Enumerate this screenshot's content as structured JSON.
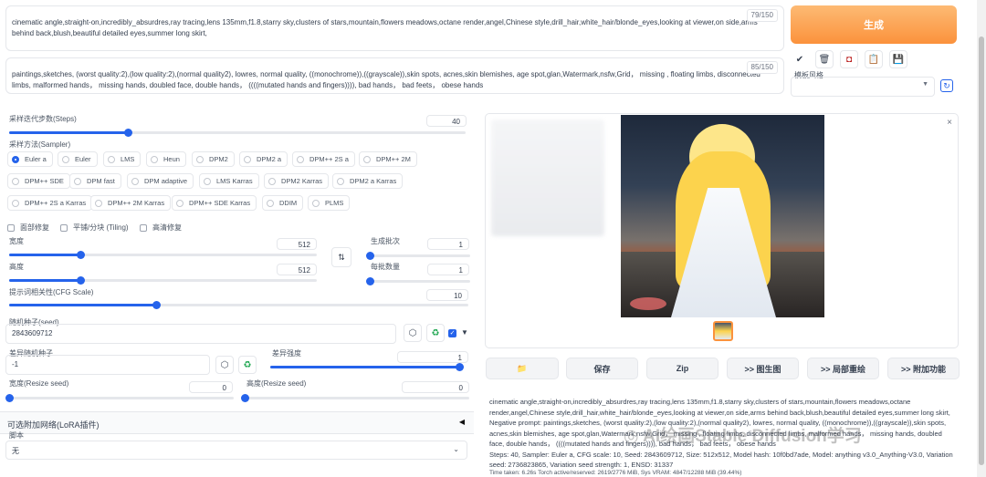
{
  "prompt": {
    "text": "cinematic angle,straight-on,incredibly_absurdres,ray tracing,lens 135mm,f1.8,starry sky,clusters of stars,mountain,flowers meadows,octane render,angel,Chinese style,drill_hair,white_hair/blonde_eyes,looking at viewer,on side,arms behind back,blush,beautiful detailed eyes,summer long skirt,",
    "count": "79/150"
  },
  "negative": {
    "text": "paintings,sketches, (worst quality:2),(low quality:2),(normal quality2), lowres, normal quality, ((monochrome)),((grayscale)),skin spots, acnes,skin blemishes, age spot,glan,Watermark,nsfw,Grid， missing , floating limbs, disconnected limbs, malformed hands， missing hands, doubled face, double hands， ((((mutated hands and fingers)))), bad hands， bad feets， obese hands",
    "count": "85/150"
  },
  "generate_label": "生成",
  "style_label": "模板风格",
  "steps": {
    "label": "采样迭代步数(Steps)",
    "value": "40",
    "fraction": 0.26
  },
  "sampler": {
    "label": "采样方法(Sampler)",
    "selected": "Euler a",
    "options": [
      "Euler a",
      "Euler",
      "LMS",
      "Heun",
      "DPM2",
      "DPM2 a",
      "DPM++ 2S a",
      "DPM++ 2M",
      "DPM++ SDE",
      "DPM fast",
      "DPM adaptive",
      "LMS Karras",
      "DPM2 Karras",
      "DPM2 a Karras",
      "DPM++ 2S a Karras",
      "DPM++ 2M Karras",
      "DPM++ SDE Karras",
      "DDIM",
      "PLMS"
    ]
  },
  "checks": {
    "face": "面部修复",
    "tiling": "平铺/分块 (Tiling)",
    "hires": "高清修复"
  },
  "width": {
    "label": "宽度",
    "value": "512",
    "fraction": 0.23
  },
  "height": {
    "label": "高度",
    "value": "512",
    "fraction": 0.23
  },
  "batch_count": {
    "label": "生成批次",
    "value": "1",
    "fraction": 0.0
  },
  "batch_size": {
    "label": "每批数量",
    "value": "1",
    "fraction": 0.0
  },
  "cfg": {
    "label": "提示词相关性(CFG Scale)",
    "value": "10",
    "fraction": 0.32
  },
  "seed": {
    "label": "随机种子(seed)",
    "value": "2843609712"
  },
  "var_seed": {
    "label": "差异随机种子",
    "value": "-1"
  },
  "var_strength": {
    "label": "差异强度",
    "value": "1",
    "fraction": 1.0
  },
  "resize_w": {
    "label": "宽度(Resize seed)",
    "value": "0",
    "fraction": 0.0
  },
  "resize_h": {
    "label": "高度(Resize seed)",
    "value": "0",
    "fraction": 0.0
  },
  "lora": {
    "label": "可选附加网络(LoRA插件)"
  },
  "script": {
    "label": "脚本",
    "value": "无"
  },
  "actions": [
    "保存",
    "Zip",
    ">> 图生图",
    ">> 局部重绘",
    ">> 附加功能"
  ],
  "info": {
    "line1": "cinematic angle,straight-on,incredibly_absurdres,ray tracing,lens 135mm,f1.8,starry sky,clusters of stars,mountain,flowers meadows,octane render,angel,Chinese style,drill_hair,white_hair/blonde_eyes,looking at viewer,on side,arms behind back,blush,beautiful detailed eyes,summer long skirt,",
    "line2": "Negative prompt: paintings,sketches, (worst quality:2),(low quality:2),(normal quality2), lowres, normal quality, ((monochrome)),((grayscale)),skin spots, acnes,skin blemishes, age spot,glan,Watermark,nsfw,Grid， missing , floating limbs, disconnected limbs, malformed hands， missing hands, doubled face, double hands， ((((mutated hands and fingers)))), bad hands， bad feets， obese hands",
    "params": "Steps: 40, Sampler: Euler a, CFG scale: 10, Seed: 2843609712, Size: 512x512, Model hash: 10f0bd7ade, Model: anything v3.0_Anything-V3.0, Variation seed: 2736823865, Variation seed strength: 1, ENSD: 31337",
    "time": "Time taken: 6.26s  Torch active/reserved: 2619/2776 MiB, Sys VRAM: 4847/12288 MiB (39.44%)"
  },
  "watermark": "AI绘画Stable Diffusion学习",
  "colors": {
    "accent": "#2563eb",
    "generate": "#fb923c"
  }
}
